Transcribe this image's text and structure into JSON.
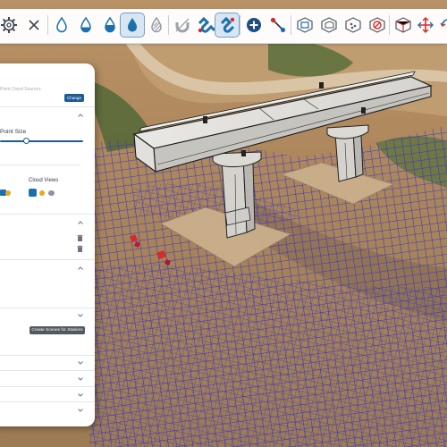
{
  "panel": {
    "partial_label": "Point Cloud Sources",
    "change_label": "Change",
    "point_size_label": "Point Size",
    "point_size_fraction": 0.32,
    "cloud_views_label": "Cloud Views",
    "create_scenes_label": "Create Scenes for Stations"
  },
  "colors": {
    "brand_blue": "#1f5a94",
    "toolbar_icon_blue": "#1b6fae",
    "mesh_blue": "#2b2fd8",
    "accent_red": "#d62a2a"
  },
  "toolbar": {
    "tools": [
      "gear-icon",
      "close-icon",
      "droplet-outline-icon",
      "droplet-half-icon",
      "droplet-filled-icon",
      "droplet-active-icon",
      "droplet-striped-icon",
      "magnet-disabled-icon",
      "magnet-blue-icon",
      "magnet-active-icon",
      "add-point-icon",
      "measure-line-icon",
      "cube-section-icon",
      "cube-box-icon",
      "cube-points-icon",
      "cube-disabled-icon",
      "cube-clip-icon",
      "split-arrows-icon",
      "rotate-arrows-icon",
      "settings-arrows-icon"
    ]
  }
}
